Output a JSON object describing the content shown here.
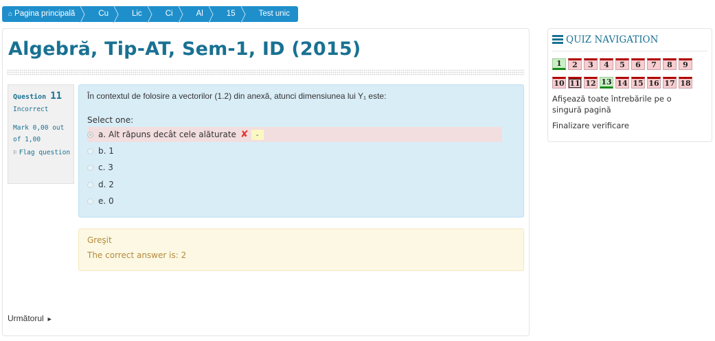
{
  "breadcrumb": [
    {
      "label": "Pagina principală",
      "icon": "home-icon"
    },
    {
      "label": "Cu"
    },
    {
      "label": "Lic"
    },
    {
      "label": "Ci"
    },
    {
      "label": "Al"
    },
    {
      "label": "15"
    },
    {
      "label": "Test unic"
    }
  ],
  "page": {
    "title": "Algebră, Tip-AT, Sem-1, ID (2015)"
  },
  "question": {
    "label": "Question",
    "number": "11",
    "state": "Incorrect",
    "mark": "Mark 0,00 out of 1,00",
    "flag_label": "Flag question",
    "text": "În contextul de folosire a vectorilor (1.2) din anexă, atunci dimensiunea lui Y₁ este:",
    "prompt": "Select one:",
    "options": [
      {
        "label": "a. Alt răpuns decât cele alăturate",
        "selected": true,
        "mark_icon": "cross-icon",
        "score": "-"
      },
      {
        "label": "b. 1"
      },
      {
        "label": "c. 3"
      },
      {
        "label": "d. 2"
      },
      {
        "label": "e. 0"
      }
    ]
  },
  "outcome": {
    "status": "Greşit",
    "correct": "The correct answer is: 2"
  },
  "next_label": "Următorul",
  "nav": {
    "title": "QUIZ NAVIGATION",
    "row1": [
      {
        "n": "1",
        "state": "correct"
      },
      {
        "n": "2",
        "state": "incorrect"
      },
      {
        "n": "3",
        "state": "incorrect"
      },
      {
        "n": "4",
        "state": "incorrect"
      },
      {
        "n": "5",
        "state": "incorrect"
      },
      {
        "n": "6",
        "state": "incorrect"
      },
      {
        "n": "7",
        "state": "incorrect"
      },
      {
        "n": "8",
        "state": "incorrect"
      },
      {
        "n": "9",
        "state": "incorrect"
      }
    ],
    "row2": [
      {
        "n": "10",
        "state": "incorrect"
      },
      {
        "n": "11",
        "state": "incorrect",
        "current": true
      },
      {
        "n": "12",
        "state": "incorrect"
      },
      {
        "n": "13",
        "state": "correct"
      },
      {
        "n": "14",
        "state": "incorrect"
      },
      {
        "n": "15",
        "state": "incorrect"
      },
      {
        "n": "16",
        "state": "incorrect"
      },
      {
        "n": "17",
        "state": "incorrect"
      },
      {
        "n": "18",
        "state": "incorrect"
      }
    ],
    "show_all": "Afişează toate întrebările pe o singură pagină",
    "finish": "Finalizare verificare"
  },
  "colors": {
    "accent": "#197192",
    "breadcrumb": "#1f8fcb",
    "incorrect": "#f2dede",
    "info": "#d9edf7",
    "warning": "#fcf8e3"
  }
}
